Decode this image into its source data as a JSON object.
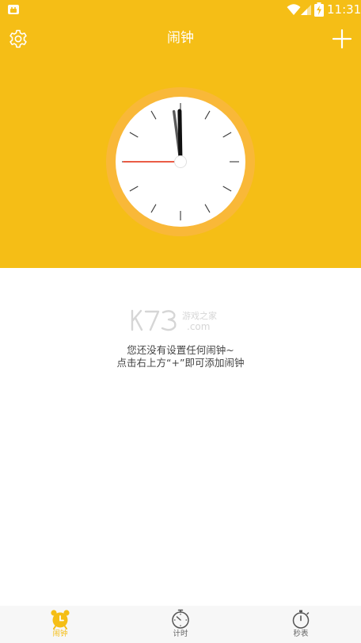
{
  "status_bar": {
    "time": "11:31"
  },
  "app_bar": {
    "title": "闹钟",
    "settings_icon": "gear-icon",
    "add_icon": "plus-icon"
  },
  "clock_face": {
    "hour": 11,
    "minute": 58,
    "second": 45,
    "outer_ring_color": "#F9B838",
    "face_color": "#FFFFFF",
    "second_hand_color": "#E8452C"
  },
  "empty_state": {
    "watermark": "K73 游戏之家 .com",
    "line1": "您还没有设置任何闹钟~",
    "line2": "点击右上方“+”即可添加闹钟"
  },
  "bottom_nav": {
    "items": [
      {
        "label": "闹钟",
        "icon": "alarm-clock-icon",
        "active": true
      },
      {
        "label": "计时",
        "icon": "timer-icon",
        "active": false
      },
      {
        "label": "秒表",
        "icon": "stopwatch-icon",
        "active": false
      }
    ]
  },
  "colors": {
    "primary": "#F5BE16",
    "nav_background": "#F7F7F7",
    "text": "#444444"
  }
}
